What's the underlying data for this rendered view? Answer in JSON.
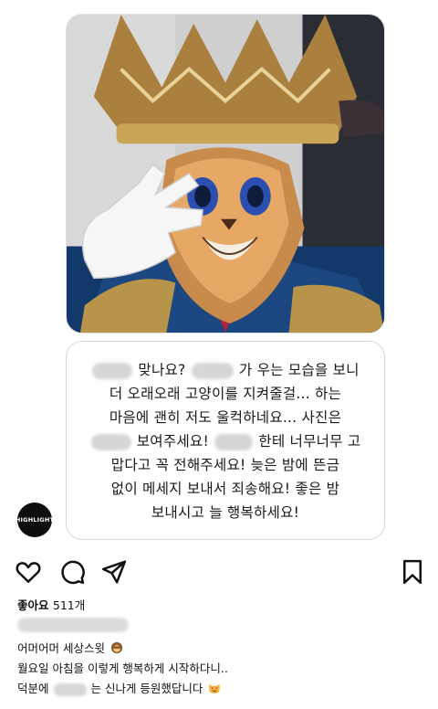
{
  "post": {
    "channel_logo_text": "HIGHLIGHT",
    "photo_subject": "masked-performer-crown-costume",
    "message_lines": [
      {
        "before": "",
        "after": "맞나요?",
        "trail": "가 우는 모습을 보니"
      },
      {
        "text": "더 오래오래 고양이를 지켜줄걸... 하는"
      },
      {
        "text": "마음에 괜히 저도 울컥하네요... 사진은"
      },
      {
        "before": "",
        "mid": "보여주세요!",
        "trail": "한테 너무너무 고"
      },
      {
        "text": "맙다고 꼭 전해주세요! 늦은 밤에 뜬금"
      },
      {
        "text": "없이 메세지 보내서 죄송해요! 좋은 밤"
      },
      {
        "text": "보내시고 늘 행복하세요!"
      }
    ]
  },
  "actions": {
    "like_icon": "heart-icon",
    "comment_icon": "comment-icon",
    "share_icon": "send-icon",
    "save_icon": "bookmark-icon"
  },
  "likes": {
    "label": "좋아요",
    "count": "511개"
  },
  "caption": {
    "line1": "어머어머 세상스윗",
    "line2": "월요일 아침을 이렇게 행복하게 시작하다니..",
    "line3_before": "덕분에",
    "line3_after": "는 신나게 등원했답니다"
  },
  "colors": {
    "text": "#111111",
    "bubble_border": "#d8d8d8",
    "blur": "#d6d6d6"
  }
}
